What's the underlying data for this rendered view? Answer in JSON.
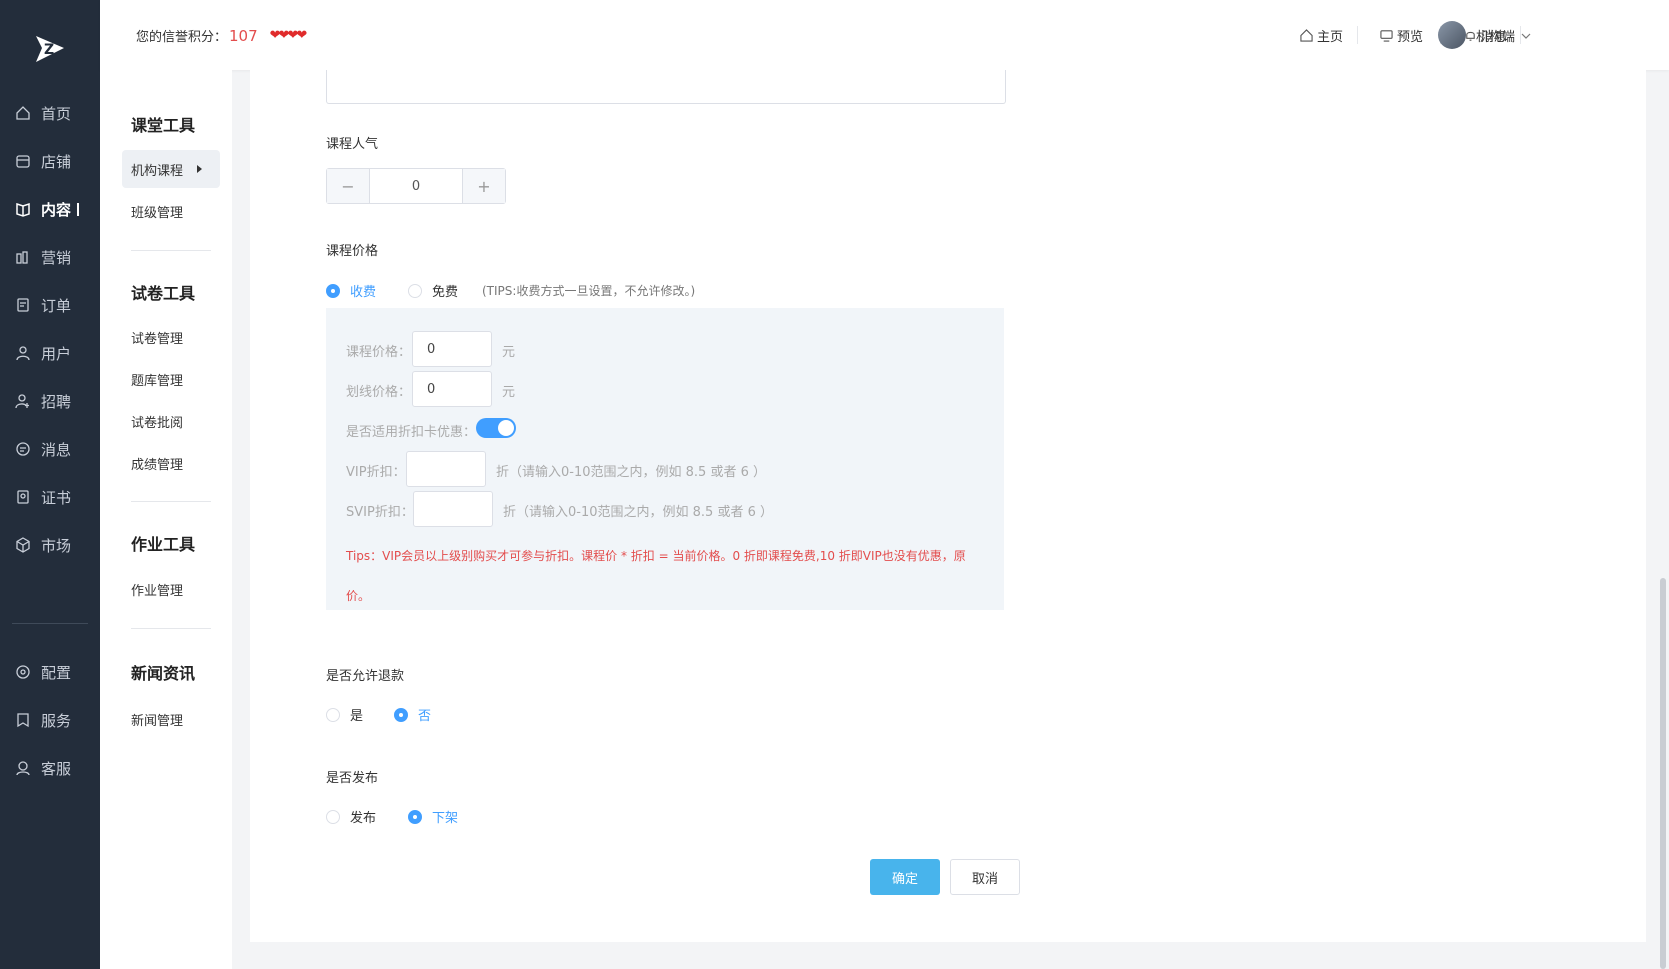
{
  "header": {
    "credit_label": "您的信誉积分：",
    "credit_score": "107",
    "hearts": "❤❤❤❤",
    "links": {
      "home": "主页",
      "preview": "预览",
      "messages": "消息"
    },
    "account": "机构端"
  },
  "sidebar": {
    "items": [
      {
        "label": "首页",
        "icon": "home-icon"
      },
      {
        "label": "店铺",
        "icon": "store-icon"
      },
      {
        "label": "内容",
        "icon": "book-icon"
      },
      {
        "label": "营销",
        "icon": "chart-icon"
      },
      {
        "label": "订单",
        "icon": "order-icon"
      },
      {
        "label": "用户",
        "icon": "user-icon"
      },
      {
        "label": "招聘",
        "icon": "recruit-icon"
      },
      {
        "label": "消息",
        "icon": "message-icon"
      },
      {
        "label": "证书",
        "icon": "certificate-icon"
      },
      {
        "label": "市场",
        "icon": "market-icon"
      },
      {
        "label": "配置",
        "icon": "gear-icon"
      },
      {
        "label": "服务",
        "icon": "bookmark-icon"
      },
      {
        "label": "客服",
        "icon": "support-icon"
      }
    ],
    "active": "内容"
  },
  "submenu": {
    "groups": [
      {
        "title": "课堂工具",
        "items": [
          "机构课程",
          "班级管理"
        ]
      },
      {
        "title": "试卷工具",
        "items": [
          "试卷管理",
          "题库管理",
          "试卷批阅",
          "成绩管理"
        ]
      },
      {
        "title": "作业工具",
        "items": [
          "作业管理"
        ]
      },
      {
        "title": "新闻资讯",
        "items": [
          "新闻管理"
        ]
      }
    ],
    "active": "机构课程"
  },
  "form": {
    "popularity_label": "课程人气",
    "popularity_value": "0",
    "price_label": "课程价格",
    "charge_option": "收费",
    "free_option": "免费",
    "price_tips": "(TIPS:收费方式一旦设置，不允许修改。)",
    "course_price_label": "课程价格：",
    "course_price_value": "0",
    "strike_price_label": "划线价格：",
    "strike_price_value": "0",
    "yuan": "元",
    "discount_card_label": "是否适用折扣卡优惠：",
    "discount_card_enabled": true,
    "vip_label": "VIP折扣：",
    "vip_hint": "折（请输入0-10范围之内，例如 8.5 或者 6 ）",
    "svip_label": "SVIP折扣：",
    "svip_hint": "折（请输入0-10范围之内，例如 8.5 或者 6 ）",
    "red_tips": "Tips：VIP会员以上级别购买才可参与折扣。课程价 * 折扣 = 当前价格。0 折即课程免费,10 折即VIP也没有优惠，原价。",
    "refund_label": "是否允许退款",
    "refund_yes": "是",
    "refund_no": "否",
    "publish_label": "是否发布",
    "publish_on": "发布",
    "publish_off": "下架",
    "confirm": "确定",
    "cancel": "取消"
  },
  "colors": {
    "accent": "#409eff",
    "sidebar_bg": "#232d3b",
    "danger": "#e34d4d"
  }
}
